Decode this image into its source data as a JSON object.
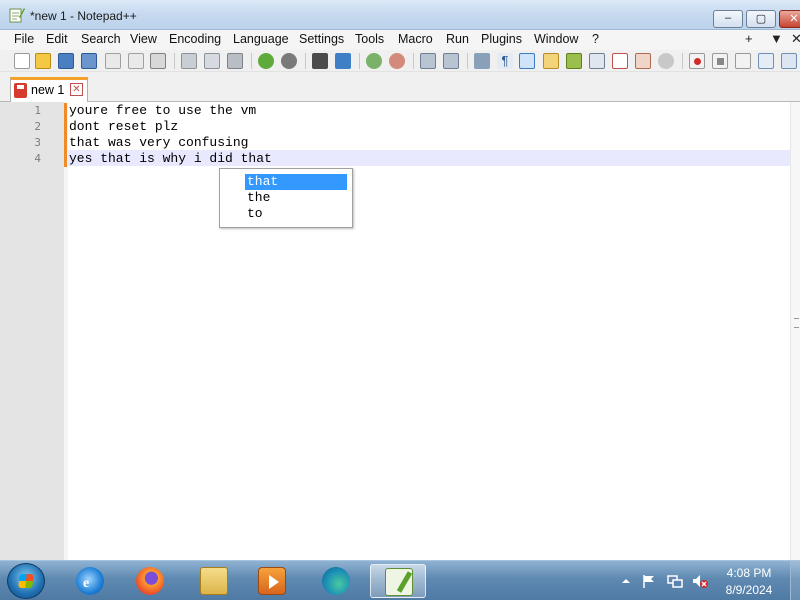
{
  "window": {
    "title": "*new 1 - Notepad++",
    "minimize": "–",
    "maximize": "▢",
    "close": "✕"
  },
  "menu": {
    "items": [
      "File",
      "Edit",
      "Search",
      "View",
      "Encoding",
      "Language",
      "Settings",
      "Tools",
      "Macro",
      "Run",
      "Plugins",
      "Window",
      "?"
    ],
    "right": [
      "+",
      "▼",
      "✕"
    ]
  },
  "toolbar": {
    "icons": [
      "new-file-icon",
      "open-file-icon",
      "save-icon",
      "save-all-icon",
      "close-icon",
      "close-all-icon",
      "print-icon",
      "cut-icon",
      "copy-icon",
      "paste-icon",
      "undo-icon",
      "redo-icon",
      "find-icon",
      "replace-icon",
      "zoom-in-icon",
      "zoom-out-icon",
      "sync-vertical-icon",
      "sync-horizontal-icon",
      "word-wrap-icon",
      "show-all-chars-icon",
      "indent-guide-icon",
      "udl-icon",
      "doc-map-icon",
      "function-list-icon",
      "folder-workspace-icon",
      "monitoring-icon",
      "record-macro-icon",
      "stop-macro-icon",
      "play-macro-icon",
      "run-macro-multiple-icon",
      "save-macro-icon"
    ]
  },
  "tabs": [
    {
      "label": "new 1",
      "close": "✕"
    }
  ],
  "editor": {
    "line_numbers": [
      "1",
      "2",
      "3",
      "4"
    ],
    "lines": [
      "youre free to use the vm",
      "dont reset plz",
      "that was very confusing",
      "yes that is why i did that"
    ],
    "current_line": 4
  },
  "autocomplete": {
    "items": [
      "that",
      "the",
      "to"
    ],
    "selected_index": 0
  },
  "taskbar": {
    "apps": [
      "internet-explorer-icon",
      "firefox-icon",
      "file-explorer-icon",
      "media-player-icon",
      "edge-icon",
      "notepad-plus-plus-icon"
    ],
    "active_app": "notepad-plus-plus-icon",
    "time": "4:08 PM",
    "date": "8/9/2024"
  },
  "colors": {
    "current_line": "#e8e8ff",
    "autocomplete_selected": "#3399ff",
    "change_marker": "#f08c28",
    "tab_accent": "#f5a028"
  }
}
